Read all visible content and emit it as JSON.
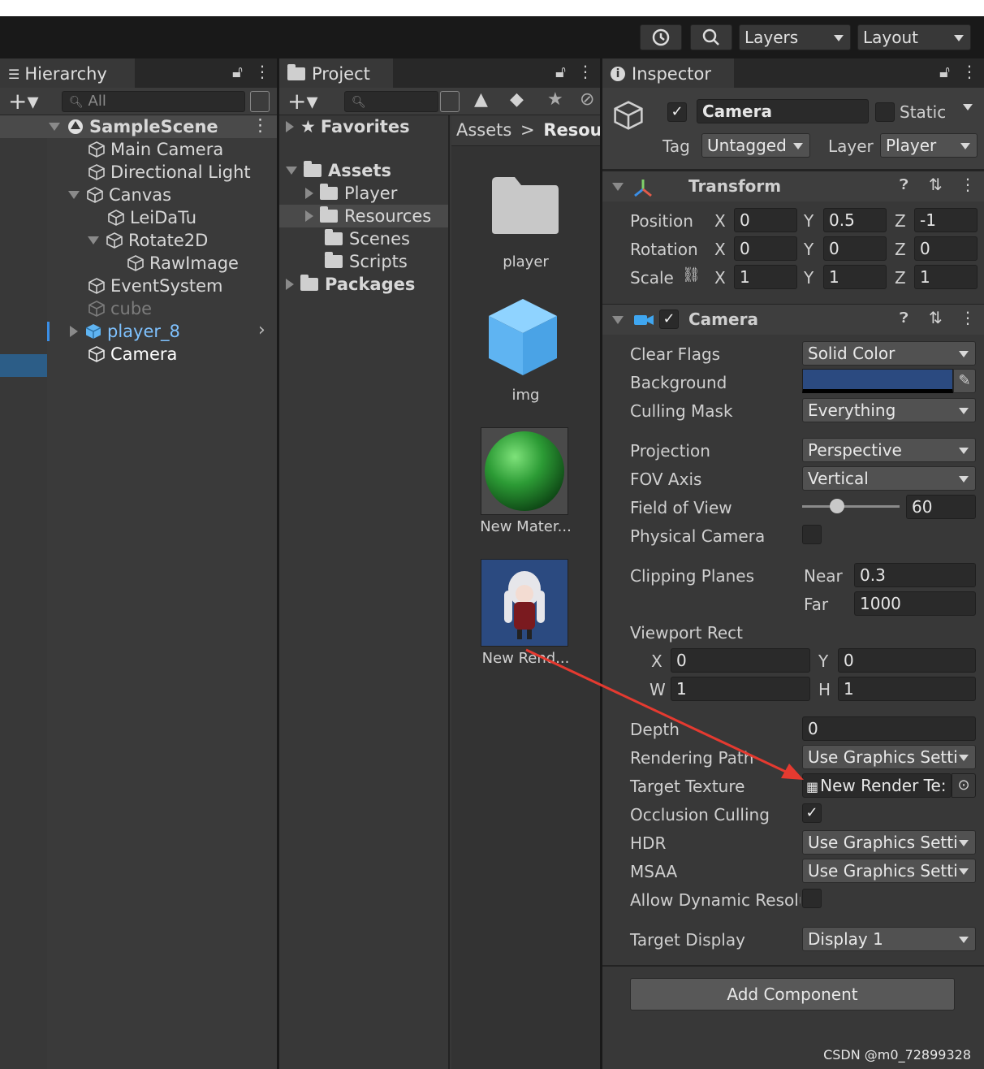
{
  "toolbar": {
    "layers": "Layers",
    "layout": "Layout"
  },
  "hierarchy": {
    "tab": "Hierarchy",
    "search": "All",
    "scene": "SampleScene",
    "items": [
      "Main Camera",
      "Directional Light",
      "Canvas",
      "LeiDaTu",
      "Rotate2D",
      "RawImage",
      "EventSystem",
      "cube",
      "player_8",
      "Camera"
    ]
  },
  "project": {
    "tab": "Project",
    "breadcrumb": {
      "root": "Assets",
      "sep": ">",
      "current": "Resourc"
    },
    "tree": {
      "favorites": "Favorites",
      "assets": "Assets",
      "player": "Player",
      "resources": "Resources",
      "scenes": "Scenes",
      "scripts": "Scripts",
      "packages": "Packages"
    },
    "assets": [
      "player",
      "img",
      "New Mater...",
      "New Rend..."
    ]
  },
  "inspector": {
    "tab": "Inspector",
    "object_name": "Camera",
    "static": "Static",
    "tag_label": "Tag",
    "tag": "Untagged",
    "layer_label": "Layer",
    "layer": "Player",
    "transform": {
      "title": "Transform",
      "position": "Position",
      "rotation": "Rotation",
      "scale": "Scale",
      "x": "X",
      "y": "Y",
      "z": "Z",
      "pos": [
        "0",
        "0.5",
        "-1"
      ],
      "rot": [
        "0",
        "0",
        "0"
      ],
      "scl": [
        "1",
        "1",
        "1"
      ]
    },
    "camera": {
      "title": "Camera",
      "clear_flags": "Clear Flags",
      "clear_flags_value": "Solid Color",
      "background": "Background",
      "culling_mask": "Culling Mask",
      "culling_mask_value": "Everything",
      "projection": "Projection",
      "projection_value": "Perspective",
      "fov_axis": "FOV Axis",
      "fov_axis_value": "Vertical",
      "fov": "Field of View",
      "fov_value": "60",
      "physical": "Physical Camera",
      "clipping": "Clipping Planes",
      "near": "Near",
      "near_value": "0.3",
      "far": "Far",
      "far_value": "1000",
      "viewport": "Viewport Rect",
      "vx": "X",
      "vx_value": "0",
      "vy": "Y",
      "vy_value": "0",
      "vw": "W",
      "vw_value": "1",
      "vh": "H",
      "vh_value": "1",
      "depth": "Depth",
      "depth_value": "0",
      "rendering_path": "Rendering Path",
      "rendering_path_value": "Use Graphics Setti",
      "target_texture": "Target Texture",
      "target_texture_value": "New Render Te:",
      "occlusion": "Occlusion Culling",
      "hdr": "HDR",
      "hdr_value": "Use Graphics Setti",
      "msaa": "MSAA",
      "msaa_value": "Use Graphics Setti",
      "dynamic": "Allow Dynamic Resolu",
      "target_display": "Target Display",
      "target_display_value": "Display 1"
    },
    "add_component": "Add Component"
  },
  "watermark": "CSDN @m0_72899328",
  "colors": {
    "selection": "#2c5d87",
    "background_swatch": "#2b4a80",
    "arrow": "#e53a30"
  }
}
